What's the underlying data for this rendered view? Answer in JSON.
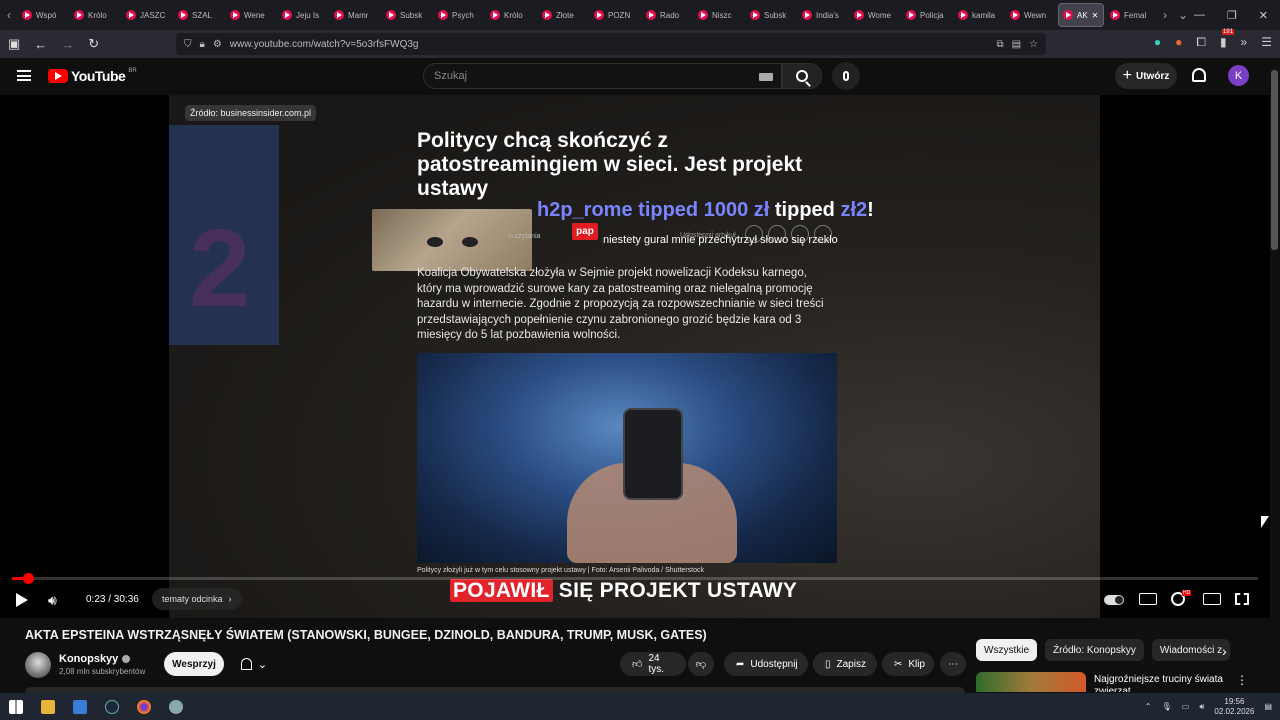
{
  "browser": {
    "tabs": [
      {
        "label": "Wspó"
      },
      {
        "label": "Królo"
      },
      {
        "label": "JASZC"
      },
      {
        "label": "SZAL"
      },
      {
        "label": "Wene"
      },
      {
        "label": "Jeju Is"
      },
      {
        "label": "Mamr"
      },
      {
        "label": "Subsk"
      },
      {
        "label": "Psych"
      },
      {
        "label": "Królo"
      },
      {
        "label": "Złote"
      },
      {
        "label": "POZN"
      },
      {
        "label": "Rado"
      },
      {
        "label": "Niszc"
      },
      {
        "label": "Subsk"
      },
      {
        "label": "India's"
      },
      {
        "label": "Wome"
      },
      {
        "label": "Policja"
      },
      {
        "label": "kamila"
      },
      {
        "label": "Wewn"
      },
      {
        "label": "AK"
      },
      {
        "label": "Femal"
      }
    ],
    "url": "www.youtube.com/watch?v=5o3rfsFWQ3g",
    "badge_count": "191"
  },
  "youtube": {
    "logo_text": "YouTube",
    "country_code": "BR",
    "search_placeholder": "Szukaj",
    "create_label": "Utwórz",
    "avatar_letter": "K"
  },
  "video": {
    "source_label": "Źródło: businessinsider.com.pl",
    "headline": "Politycy chcą skończyć z patostreamingiem w sieci. Jest projekt ustawy",
    "tip_user": "h2p_rome",
    "tip_text_1": "tipped",
    "tip_amount": "1000 zł",
    "tip_text_2": "tipped",
    "tip_amount_2": "zł2",
    "tip_exclaim": "!",
    "tip_message": "niestety gural mnie przechytrzył słowo się rzekło",
    "reading_label": "n czytania",
    "pap_label": "pap",
    "share_label": "Udostępnij artykuł",
    "article_text": "Koalicja Obywatelska złożyła w Sejmie projekt nowelizacji Kodeksu karnego, który ma wprowadzić surowe kary za patostreaming oraz nielegalną promocję hazardu w internecie. Zgodnie z propozycją za rozpowszechnianie w sieci treści przedstawiających popełnienie czynu zabronionego grozić będzie kara od 3 miesięcy do 5 lat pozbawienia wolności.",
    "photo_caption": "Politycy złożyli już w tym celu stosowny projekt ustawy  |  Foto: Arsenii Palivoda / Shutterstock",
    "subtitle_highlight": "POJAWIŁ",
    "subtitle_rest": " SIĘ PROJEKT USTAWY",
    "time_display": "0:23 / 30:36",
    "progress_fraction": 0.0125,
    "chapter_label": "tematy odcinka"
  },
  "below": {
    "title": "AKTA EPSTEINA WSTRZĄSNĘŁY ŚWIATEM (STANOWSKI, BUNGEE, DZINOLD, BANDURA, TRUMP, MUSK, GATES)",
    "channel_name": "Konopskyy",
    "subscribers": "2,08 mln subskrybentów",
    "support_label": "Wesprzyj",
    "like_count": "24 tys.",
    "share_label": "Udostępnij",
    "save_label": "Zapisz",
    "clip_label": "Klip"
  },
  "sidebar": {
    "chips": [
      {
        "label": "Wszystkie"
      },
      {
        "label": "Źródło: Konopskyy"
      },
      {
        "label": "Wiadomości z"
      }
    ],
    "rec_title": "Najgroźniejsze truciny świata zwierzat"
  },
  "taskbar": {
    "time": "19:56",
    "date": "02.02.2026"
  },
  "colors": {
    "accent_red": "#ff0000",
    "tip_blue": "#7a84ff",
    "avatar_purple": "#7b3fc4"
  }
}
